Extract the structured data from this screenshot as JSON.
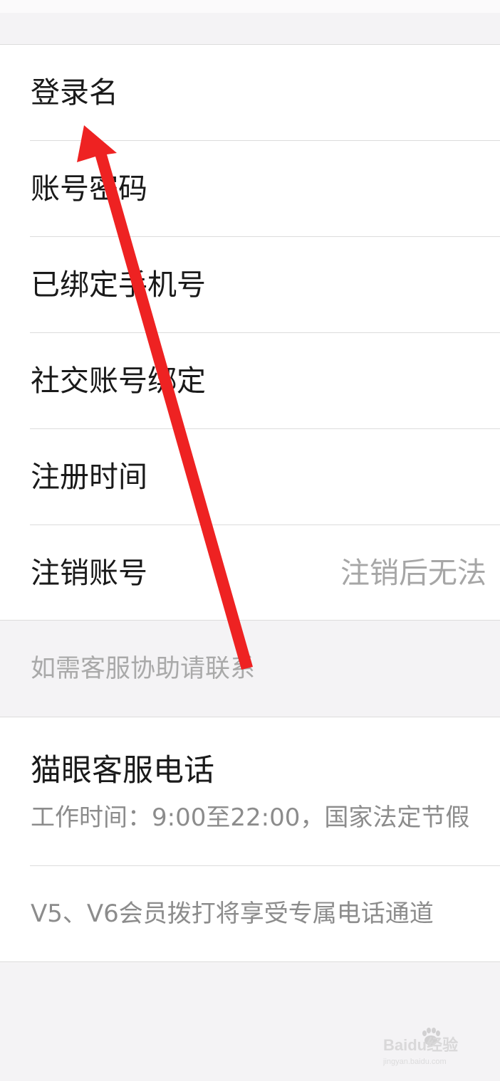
{
  "account_rows": [
    {
      "label": "登录名",
      "value": ""
    },
    {
      "label": "账号密码",
      "value": ""
    },
    {
      "label": "已绑定手机号",
      "value": ""
    },
    {
      "label": "社交账号绑定",
      "value": ""
    },
    {
      "label": "注册时间",
      "value": ""
    },
    {
      "label": "注销账号",
      "value": "注销后无法"
    }
  ],
  "support_note": "如需客服协助请联系",
  "service": {
    "title": "猫眼客服电话",
    "hours": "工作时间：9:00至22:00，国家法定节假",
    "vip_note": "V5、V6会员拨打将享受专属电话通道"
  },
  "annotation": {
    "arrow_color": "#ee2222"
  },
  "watermark": {
    "brand": "Baidu经验",
    "url": "jingyan.baidu.com"
  }
}
